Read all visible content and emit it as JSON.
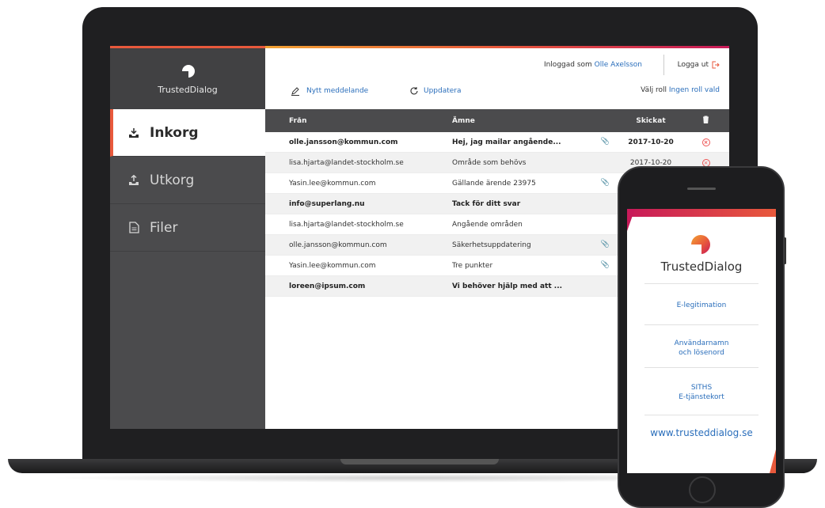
{
  "brand": {
    "name": "TrustedDialog"
  },
  "sidebar": {
    "items": [
      {
        "label": "Inkorg",
        "active": true
      },
      {
        "label": "Utkorg",
        "active": false
      },
      {
        "label": "Filer",
        "active": false
      }
    ]
  },
  "header": {
    "logged_in_prefix": "Inloggad som",
    "user_name": "Olle Axelsson",
    "logout_label": "Logga ut",
    "new_message_label": "Nytt meddelande",
    "refresh_label": "Uppdatera",
    "role_prefix": "Välj roll",
    "role_value": "Ingen roll vald"
  },
  "table": {
    "columns": {
      "from": "Från",
      "subject": "Ämne",
      "sent": "Skickat"
    },
    "rows": [
      {
        "from": "olle.jansson@kommun.com",
        "subject": "Hej, jag mailar angående...",
        "sent": "2017-10-20",
        "bold": true,
        "attachment": true
      },
      {
        "from": "lisa.hjarta@landet-stockholm.se",
        "subject": "Område som behövs",
        "sent": "2017-10-20",
        "bold": false,
        "attachment": false
      },
      {
        "from": "Yasin.lee@kommun.com",
        "subject": "Gällande ärende 23975",
        "sent": "",
        "bold": false,
        "attachment": true
      },
      {
        "from": "info@superlang.nu",
        "subject": "Tack för ditt svar",
        "sent": "",
        "bold": true,
        "attachment": false
      },
      {
        "from": "lisa.hjarta@landet-stockholm.se",
        "subject": "Angående områden",
        "sent": "",
        "bold": false,
        "attachment": false
      },
      {
        "from": "olle.jansson@kommun.com",
        "subject": "Säkerhetsuppdatering",
        "sent": "",
        "bold": false,
        "attachment": true
      },
      {
        "from": "Yasin.lee@kommun.com",
        "subject": "Tre punkter",
        "sent": "",
        "bold": false,
        "attachment": true
      },
      {
        "from": "loreen@ipsum.com",
        "subject": "Vi behöver hjälp med att ...",
        "sent": "",
        "bold": true,
        "attachment": false
      }
    ]
  },
  "phone": {
    "brand": "TrustedDialog",
    "login_options": [
      "E-legitimation",
      "Användarnamn\noch lösenord",
      "SITHS\nE-tjänstekort"
    ],
    "url": "www.trusteddialog.se"
  },
  "colors": {
    "accent": "#e8593c",
    "link": "#2a6ebb",
    "sidebar": "#4b4b4d",
    "magenta": "#c81a59"
  }
}
